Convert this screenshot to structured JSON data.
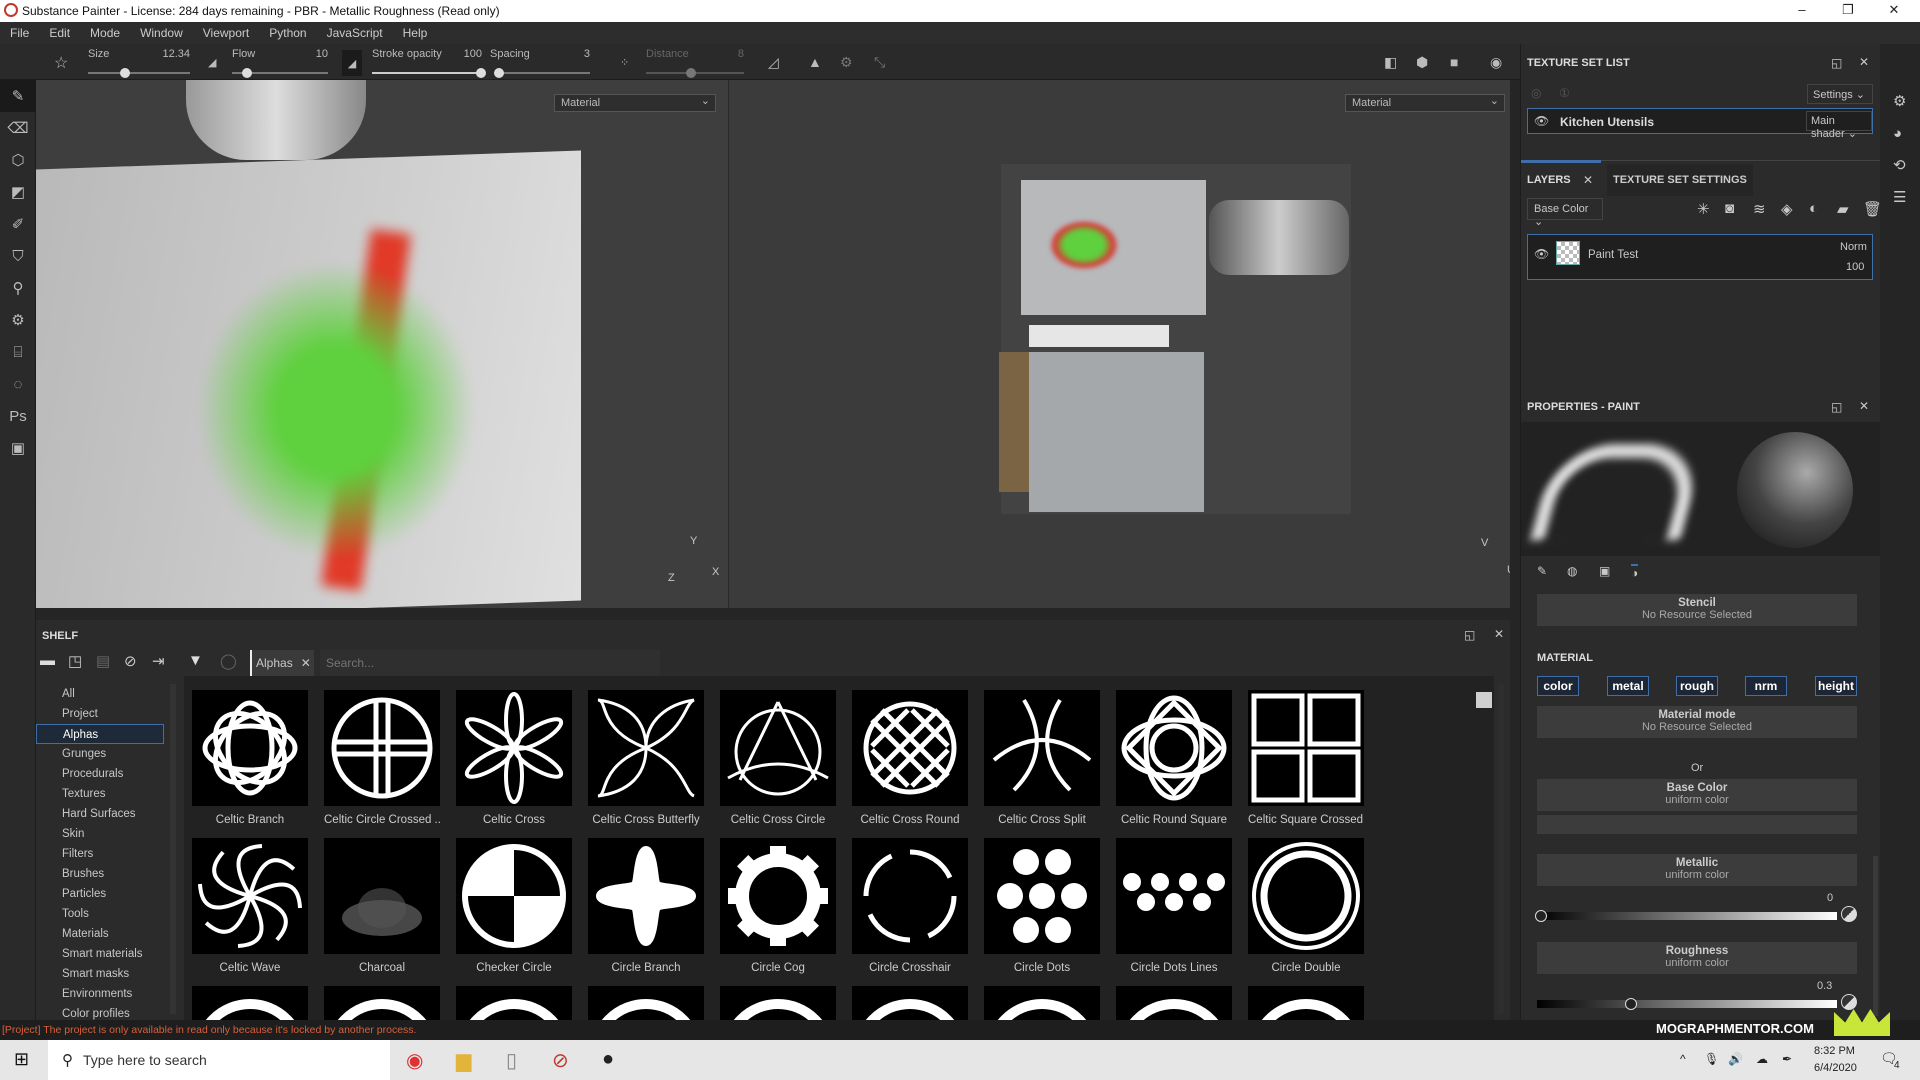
{
  "window": {
    "title": "Substance Painter - License: 284 days remaining - PBR - Metallic Roughness (Read only)"
  },
  "menu": [
    "File",
    "Edit",
    "Mode",
    "Window",
    "Viewport",
    "Python",
    "JavaScript",
    "Help"
  ],
  "toolbar": {
    "size_label": "Size",
    "size_value": "12.34",
    "flow_label": "Flow",
    "flow_value": "10",
    "stroke_opacity_label": "Stroke opacity",
    "stroke_opacity_value": "100",
    "spacing_label": "Spacing",
    "spacing_value": "3",
    "distance_label": "Distance",
    "distance_value": "8"
  },
  "viewport3d": {
    "mode": "Material",
    "axes": [
      "Y",
      "Z",
      "X"
    ]
  },
  "viewport2d": {
    "mode": "Material",
    "axes": [
      "V",
      "U"
    ]
  },
  "shelf": {
    "title": "SHELF",
    "filter_tag": "Alphas",
    "search_placeholder": "Search...",
    "categories": [
      "All",
      "Project",
      "Alphas",
      "Grunges",
      "Procedurals",
      "Textures",
      "Hard Surfaces",
      "Skin",
      "Filters",
      "Brushes",
      "Particles",
      "Tools",
      "Materials",
      "Smart materials",
      "Smart masks",
      "Environments",
      "Color profiles"
    ],
    "selected_category": "Alphas",
    "items": [
      "Celtic Branch",
      "Celtic Circle Crossed ...",
      "Celtic Cross",
      "Celtic Cross Butterfly",
      "Celtic Cross Circle",
      "Celtic Cross Round",
      "Celtic Cross Split",
      "Celtic Round Square",
      "Celtic Square Crossed...",
      "Celtic Wave",
      "Charcoal",
      "Checker Circle",
      "Circle Branch",
      "Circle Cog",
      "Circle Crosshair",
      "Circle Dots",
      "Circle Dots Lines",
      "Circle Double"
    ]
  },
  "texture_set_list": {
    "title": "TEXTURE SET LIST",
    "settings": "Settings",
    "set_name": "Kitchen Utensils",
    "shader": "Main shader"
  },
  "layers": {
    "tab_layers": "LAYERS",
    "tab_tss": "TEXTURE SET SETTINGS",
    "channel": "Base Color",
    "layer_name": "Paint Test",
    "blend": "Norm",
    "opacity": "100"
  },
  "properties": {
    "title": "PROPERTIES - PAINT",
    "stencil_title": "Stencil",
    "stencil_value": "No Resource Selected",
    "material_label": "MATERIAL",
    "channels": [
      "color",
      "metal",
      "rough",
      "nrm",
      "height"
    ],
    "material_mode_title": "Material mode",
    "material_mode_value": "No Resource Selected",
    "or_label": "Or",
    "base_color_title": "Base Color",
    "base_color_value": "uniform color",
    "metallic_title": "Metallic",
    "metallic_value": "uniform color",
    "metallic_number": "0",
    "roughness_title": "Roughness",
    "roughness_value": "uniform color",
    "roughness_number": "0.3"
  },
  "status": {
    "message": "[Project] The project is only available in read only because it's locked by another process."
  },
  "taskbar": {
    "search_placeholder": "Type here to search",
    "time": "8:32 PM",
    "date": "6/4/2020",
    "notifications": "4"
  },
  "watermark": {
    "brand": "MOGRAPHMENTOR.COM"
  },
  "colors": {
    "accent": "#3f6ea8",
    "status_error": "#d9603a"
  }
}
